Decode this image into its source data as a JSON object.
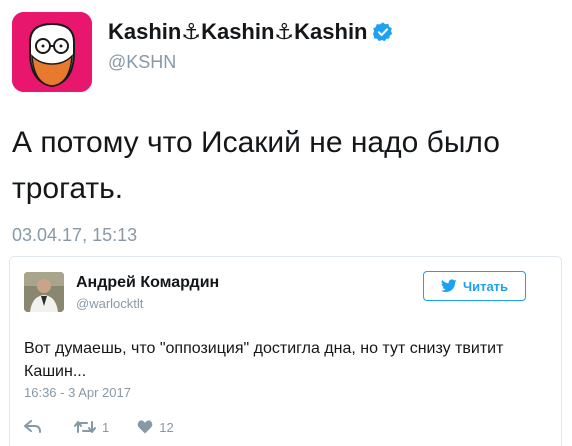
{
  "outer_tweet": {
    "display_name": "Kashin⚓Kashin⚓Kashin",
    "handle": "@KSHN",
    "text": "А потому что Исакий не надо было трогать.",
    "date": "03.04.17, 15:13",
    "verified_icon": "verified-badge-icon",
    "avatar_color": "#e8166d"
  },
  "embedded_tweet": {
    "display_name": "Андрей Комардин",
    "handle": "@warlocktlt",
    "follow_label": "Читать",
    "text": "Вот думаешь, что \"оппозиция\" достигла дна, но тут снизу твитит Кашин...",
    "date": "16:36 - 3 Apr 2017",
    "retweet_count": "1",
    "like_count": "12"
  },
  "colors": {
    "accent": "#1da1f2",
    "muted": "#8899a6",
    "text": "#14171a",
    "border": "#e1e8ed"
  }
}
